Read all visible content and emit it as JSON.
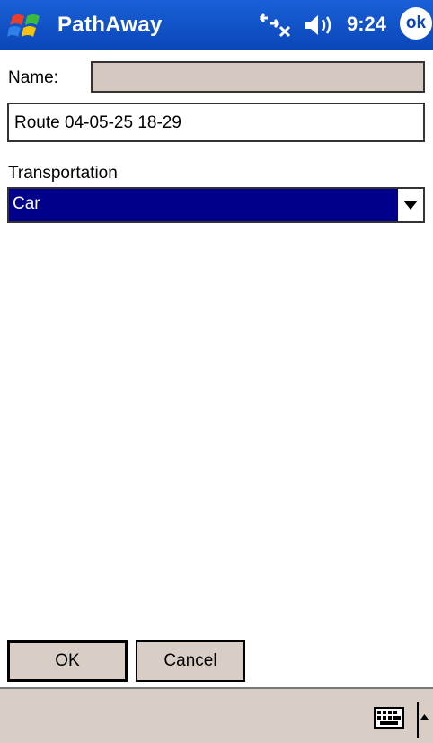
{
  "title_bar": {
    "app_title": "PathAway",
    "time": "9:24",
    "ok_label": "ok"
  },
  "form": {
    "name_label": "Name:",
    "name_value": "",
    "route_value": "Route 04-05-25 18-29",
    "transportation_label": "Transportation",
    "transportation_selected": "Car"
  },
  "buttons": {
    "ok_label": "OK",
    "cancel_label": "Cancel"
  },
  "icons": {
    "start": "windows-flag-icon",
    "connectivity": "connectivity-icon",
    "volume": "speaker-icon",
    "keyboard": "keyboard-icon",
    "sip_toggle": "up-arrow-icon",
    "dropdown": "chevron-down-icon"
  },
  "colors": {
    "title_bar": "#0a46b8",
    "selection": "#00008a",
    "chrome": "#d9cec6"
  }
}
